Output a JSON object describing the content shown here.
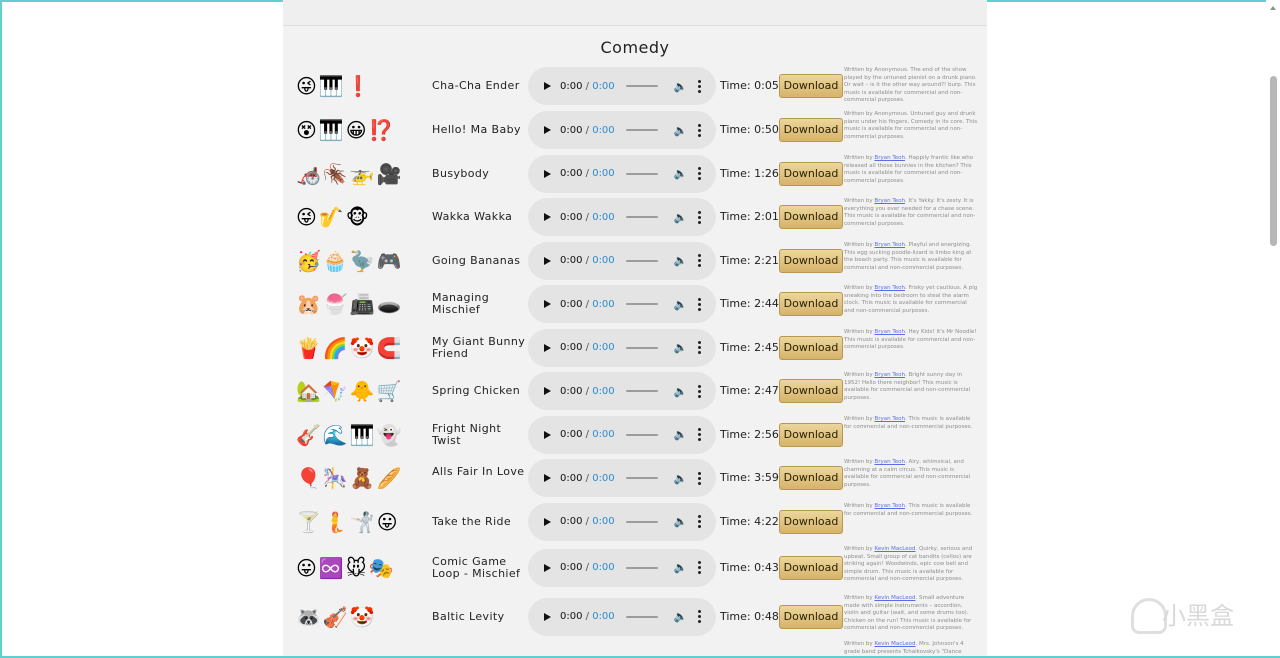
{
  "section": {
    "title": "Comedy"
  },
  "common": {
    "play_start": "0:00",
    "separator": " / ",
    "time_label": "Time:",
    "download_label": "Download",
    "desc_written_by": "Written by",
    "volume_icon": "speaker-icon",
    "more_icon": "more-options-icon"
  },
  "tracks": [
    {
      "emojis": [
        "😜",
        "🎹",
        "❗"
      ],
      "title": "Cha-Cha Ender",
      "player_duration": "0:00",
      "time": "0:05",
      "author": "Anonymous",
      "author_link": false,
      "desc_rest": ". The end of the show played by the untuned pianist on a drunk piano. Or wait – is it the other way around?! burp. This music is available for commercial and non-commercial purposes."
    },
    {
      "emojis": [
        "😵",
        "🎹",
        "😀",
        "⁉️"
      ],
      "title": "Hello! Ma Baby",
      "player_duration": "0:00",
      "time": "0:50",
      "author": "Anonymous",
      "author_link": false,
      "desc_rest": ". Untuned guy and drunk piano under his fingers. Comedy in its core. This music is available for commercial and non-commercial purposes."
    },
    {
      "emojis": [
        "🦽",
        "🪳",
        "🚁",
        "🎥"
      ],
      "title": "Busybody",
      "player_duration": "0:00",
      "time": "1:26",
      "author": "Bryan Teoh",
      "author_link": true,
      "desc_rest": ". Happily frantic like who released all those bunnies in the kitchen? This music is available for commercial and non-commercial purposes."
    },
    {
      "emojis": [
        "😜",
        "🎷",
        "🐵"
      ],
      "title": "Wakka Wakka",
      "player_duration": "0:00",
      "time": "2:01",
      "author": "Bryan Teoh",
      "author_link": true,
      "desc_rest": ". It's Yakky. It's zesty. It is everything you ever needed for a chase scene. This music is available for commercial and non-commercial purposes."
    },
    {
      "emojis": [
        "🥳",
        "🧁",
        "🦤",
        "🎮"
      ],
      "title": "Going Bananas",
      "player_duration": "0:00",
      "time": "2:21",
      "author": "Bryan Teoh",
      "author_link": true,
      "desc_rest": ". Playful and energizing. This egg sucking poodle-lizard is limbo king at the beach party. This music is available for commercial and non-commercial purposes."
    },
    {
      "emojis": [
        "🐹",
        "🍧",
        "📠",
        "🕳️"
      ],
      "title": "Managing Mischief",
      "player_duration": "0:00",
      "time": "2:44",
      "author": "Bryan Teoh",
      "author_link": true,
      "desc_rest": ". Frisky yet cautious. A pig sneaking into the bedroom to steal the alarm clock. This music is available for commercial and non-commercial purposes."
    },
    {
      "emojis": [
        "🍟",
        "🌈",
        "🤡",
        "🧲"
      ],
      "title": "My Giant Bunny Friend",
      "player_duration": "0:00",
      "time": "2:45",
      "author": "Bryan Teoh",
      "author_link": true,
      "desc_rest": ". Hey Kids! It's Mr Noodle! This music is available for commercial and non-commercial purposes."
    },
    {
      "emojis": [
        "🏡",
        "🪁",
        "🐥",
        "🛒"
      ],
      "title": "Spring Chicken",
      "player_duration": "0:00",
      "time": "2:47",
      "author": "Bryan Teoh",
      "author_link": true,
      "desc_rest": ". Bright sunny day in 1952! Hello there neighbor! This music is available for commercial and non-commercial purposes."
    },
    {
      "emojis": [
        "🎸",
        "🌊",
        "🎹",
        "👻"
      ],
      "title": "Fright Night Twist",
      "player_duration": "0:00",
      "time": "2:56",
      "author": "Bryan Teoh",
      "author_link": true,
      "desc_rest": ". This music is available for commercial and non-commercial purposes."
    },
    {
      "emojis": [
        "🎈",
        "🎠",
        "🧸",
        "🥖"
      ],
      "title": "Alls Fair In Love",
      "player_duration": "0:00",
      "time": "3:59",
      "author": "Bryan Teoh",
      "author_link": true,
      "desc_rest": ". Airy, whimsical, and charming at a calm circus. This music is available for commercial and non-commercial purposes."
    },
    {
      "emojis": [
        "🍸",
        "🧜",
        "🤺",
        "😛"
      ],
      "title": "Take the Ride",
      "player_duration": "0:00",
      "time": "4:22",
      "author": "Bryan Teoh",
      "author_link": true,
      "desc_rest": ". This music is available for commercial and non-commercial purposes."
    },
    {
      "emojis": [
        "😛",
        "♾️",
        "🐭",
        "🎭"
      ],
      "title": "Comic Game Loop - Mischief",
      "player_duration": "0:00",
      "time": "0:43",
      "author": "Kevin MacLeod",
      "author_link": true,
      "desc_rest": ". Quirky, serious and upbeat. Small group of cat bandits (cellos) are striking again! Woodwinds, epic cow bell and simple drum. This music is available for commercial and non-commercial purposes."
    },
    {
      "emojis": [
        "🦝",
        "🎻",
        "🤡"
      ],
      "title": "Baltic Levity",
      "player_duration": "0:00",
      "time": "0:48",
      "author": "Kevin MacLeod",
      "author_link": true,
      "desc_rest": ". Small adventure made with simple instruments – accordion, violin and guitar (wait, and some drums too). Chicken on the run! This music is available for commercial and non-commercial purposes."
    },
    {
      "emojis": [],
      "title": "",
      "player_duration": "",
      "time": "",
      "author": "Kevin MacLeod",
      "author_link": true,
      "desc_rest": ". Mrs. Johnson's 4 grade band presents Tchaikovsky's \"Dance"
    }
  ],
  "watermark": {
    "text": "小黑盒"
  }
}
